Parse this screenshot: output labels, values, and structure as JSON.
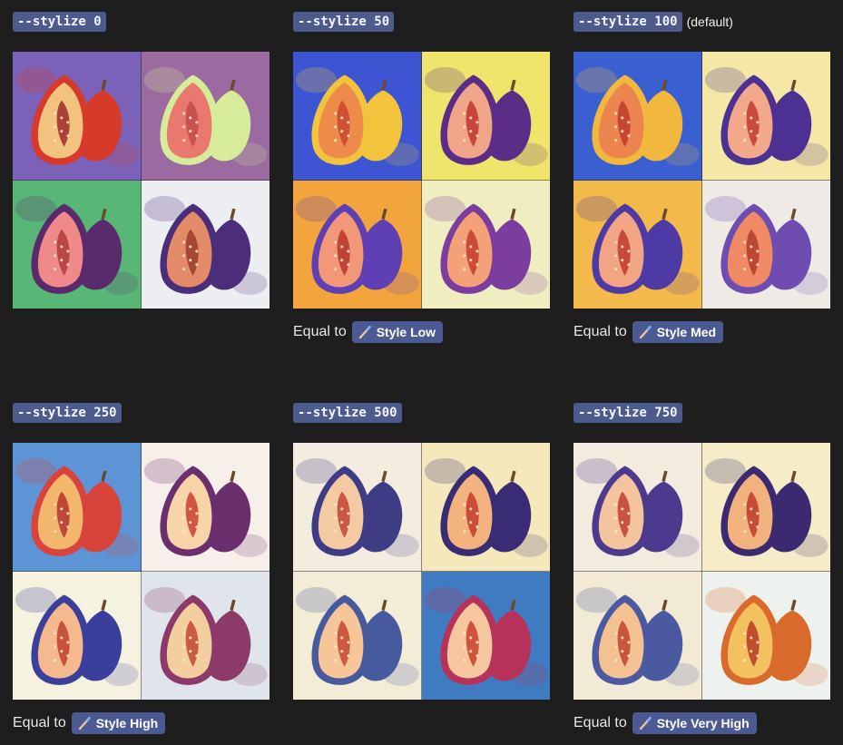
{
  "panels": [
    {
      "code": "--stylize 0",
      "note": "",
      "equal_prefix": "",
      "style_label": "",
      "tiles": [
        {
          "bg": "#7b62b8",
          "fig": "#d63a2b",
          "flesh": "#f1c37e",
          "seed": "#9e2a2a"
        },
        {
          "bg": "#9a6aa0",
          "fig": "#d7ec9a",
          "flesh": "#e9796f",
          "seed": "#c34b4b"
        },
        {
          "bg": "#58b777",
          "fig": "#5a2b6c",
          "flesh": "#f08a8a",
          "seed": "#b23a3a"
        },
        {
          "bg": "#eceef2",
          "fig": "#4c2d7a",
          "flesh": "#e38a68",
          "seed": "#9a3b2c"
        }
      ]
    },
    {
      "code": "--stylize 50",
      "note": "",
      "equal_prefix": "Equal to",
      "style_label": "Style Low",
      "tiles": [
        {
          "bg": "#3d55d2",
          "fig": "#f2c43c",
          "flesh": "#ee8b4a",
          "seed": "#c9472c"
        },
        {
          "bg": "#f1e46b",
          "fig": "#5b2d87",
          "flesh": "#f0a488",
          "seed": "#c2352f"
        },
        {
          "bg": "#f3a53d",
          "fig": "#5f3fb4",
          "flesh": "#f29778",
          "seed": "#b8342b"
        },
        {
          "bg": "#f0eec0",
          "fig": "#7b3e9f",
          "flesh": "#f4a079",
          "seed": "#c33c2a"
        }
      ]
    },
    {
      "code": "--stylize 100",
      "note": "(default)",
      "equal_prefix": "Equal to",
      "style_label": "Style Med",
      "tiles": [
        {
          "bg": "#3a5fd0",
          "fig": "#f2b83e",
          "flesh": "#ec8450",
          "seed": "#c13b2a"
        },
        {
          "bg": "#f5e8a6",
          "fig": "#4d3192",
          "flesh": "#f2a98b",
          "seed": "#c33a2f"
        },
        {
          "bg": "#f3b94a",
          "fig": "#4e3aa5",
          "flesh": "#f2a585",
          "seed": "#c0382e"
        },
        {
          "bg": "#eeebe6",
          "fig": "#6f4db0",
          "flesh": "#ef8a64",
          "seed": "#b33c2c"
        }
      ]
    },
    {
      "code": "--stylize 250",
      "note": "",
      "equal_prefix": "Equal to",
      "style_label": "Style High",
      "tiles": [
        {
          "bg": "#5d94d6",
          "fig": "#d8443b",
          "flesh": "#f2b66d",
          "seed": "#b7322c"
        },
        {
          "bg": "#f7f0ea",
          "fig": "#6b2f6e",
          "flesh": "#f7d5a8",
          "seed": "#c9402f"
        },
        {
          "bg": "#f5f2e0",
          "fig": "#3a3f9c",
          "flesh": "#f6b98d",
          "seed": "#c1402f"
        },
        {
          "bg": "#dfe5ea",
          "fig": "#8b3a6a",
          "flesh": "#f3cf9f",
          "seed": "#c14733"
        }
      ]
    },
    {
      "code": "--stylize 500",
      "note": "",
      "equal_prefix": "",
      "style_label": "",
      "tiles": [
        {
          "bg": "#f4ecdf",
          "fig": "#3d3c85",
          "flesh": "#f3caa1",
          "seed": "#c14331"
        },
        {
          "bg": "#f5e9bc",
          "fig": "#3a2c74",
          "flesh": "#f3b37e",
          "seed": "#c23a2d"
        },
        {
          "bg": "#f3ecd7",
          "fig": "#475a9e",
          "flesh": "#f6c598",
          "seed": "#c3452f"
        },
        {
          "bg": "#3f7bc0",
          "fig": "#b6325a",
          "flesh": "#f6c79e",
          "seed": "#c8402d"
        }
      ]
    },
    {
      "code": "--stylize 750",
      "note": "",
      "equal_prefix": "Equal to",
      "style_label": "Style Very High",
      "tiles": [
        {
          "bg": "#f2ebde",
          "fig": "#4b3a8e",
          "flesh": "#f3c49e",
          "seed": "#c2402f"
        },
        {
          "bg": "#f6ecc7",
          "fig": "#3b2a70",
          "flesh": "#f1b27d",
          "seed": "#c03a2b"
        },
        {
          "bg": "#f3ead6",
          "fig": "#4b5aa0",
          "flesh": "#f4c190",
          "seed": "#c2422f"
        },
        {
          "bg": "#eef2ee",
          "fig": "#d96a2b",
          "flesh": "#f3c15f",
          "seed": "#b53a24"
        }
      ]
    }
  ]
}
